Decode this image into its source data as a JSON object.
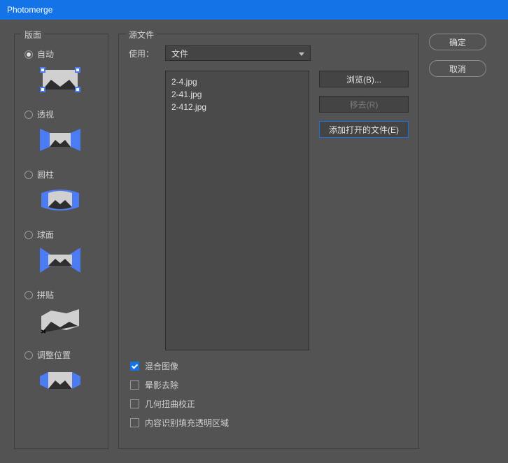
{
  "title": "Photomerge",
  "layout": {
    "group_title": "版面",
    "options": [
      {
        "label": "自动",
        "selected": true,
        "icon": "auto"
      },
      {
        "label": "透视",
        "selected": false,
        "icon": "perspective"
      },
      {
        "label": "圆柱",
        "selected": false,
        "icon": "cylindrical"
      },
      {
        "label": "球面",
        "selected": false,
        "icon": "spherical"
      },
      {
        "label": "拼贴",
        "selected": false,
        "icon": "collage"
      },
      {
        "label": "调整位置",
        "selected": false,
        "icon": "reposition"
      }
    ]
  },
  "source": {
    "group_title": "源文件",
    "use_label": "使用：",
    "use_value": "文件",
    "files": [
      "2-4.jpg",
      "2-41.jpg",
      "2-412.jpg"
    ],
    "browse_btn": "浏览(B)...",
    "remove_btn": "移去(R)",
    "add_open_btn": "添加打开的文件(E)"
  },
  "checks": {
    "blend": {
      "label": "混合图像",
      "checked": true
    },
    "vignette": {
      "label": "晕影去除",
      "checked": false
    },
    "geometric": {
      "label": "几何扭曲校正",
      "checked": false
    },
    "content_aware": {
      "label": "内容识别填充透明区域",
      "checked": false
    }
  },
  "buttons": {
    "ok": "确定",
    "cancel": "取消"
  }
}
